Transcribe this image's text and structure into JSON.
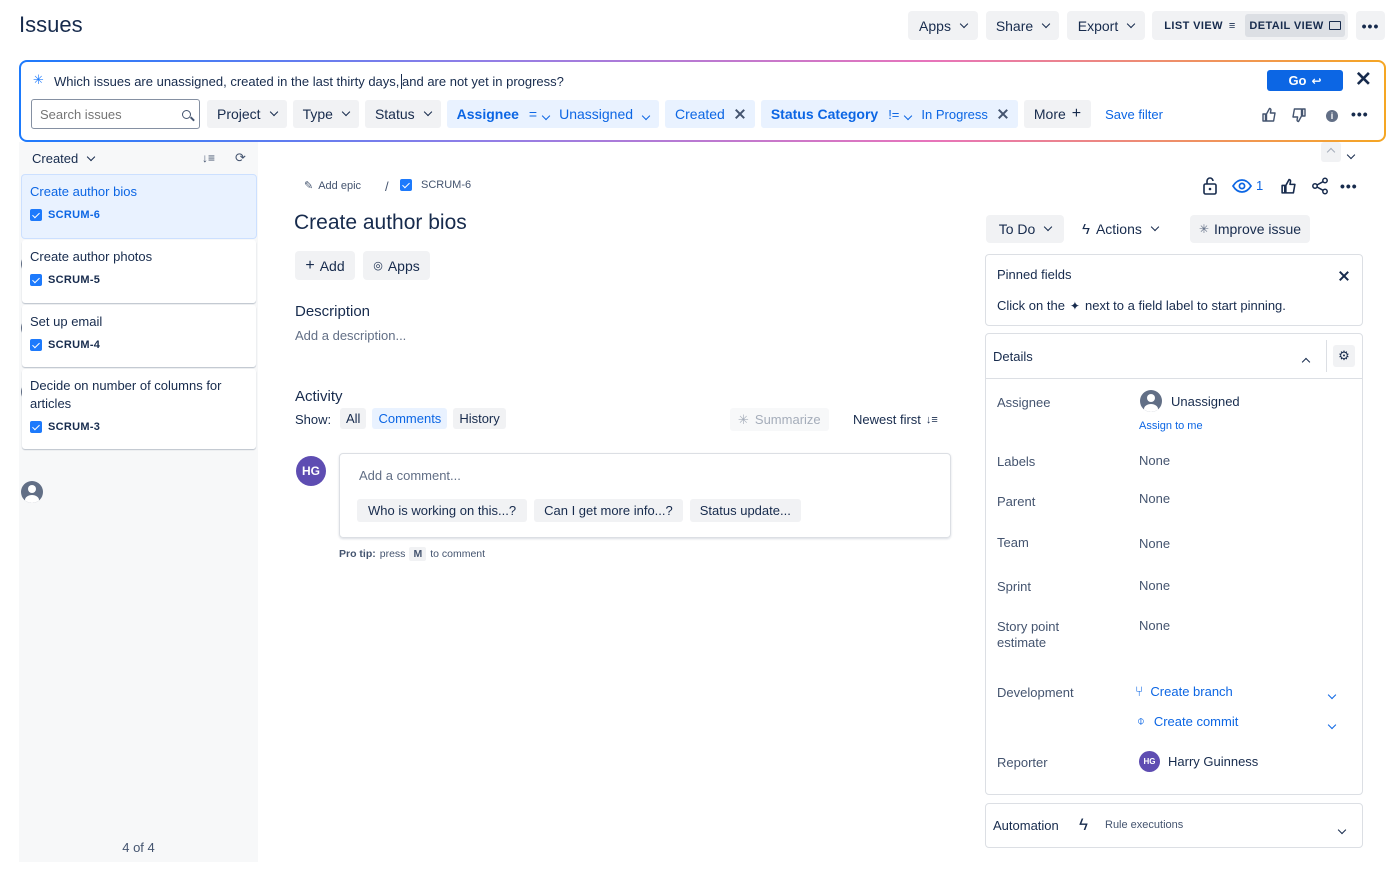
{
  "header": {
    "title": "Issues",
    "apps_label": "Apps",
    "share_label": "Share",
    "export_label": "Export",
    "list_view_label": "LIST VIEW",
    "detail_view_label": "DETAIL VIEW"
  },
  "ai_search": {
    "query_before": "Which issues are unassigned, created in the last thirty days, ",
    "query_after": "and are not yet in progress?",
    "go_label": "Go"
  },
  "filters": {
    "search_placeholder": "Search issues",
    "project": "Project",
    "type": "Type",
    "status": "Status",
    "assignee": "Assignee",
    "assignee_op": "=",
    "assignee_value": "Unassigned",
    "created": "Created",
    "status_category": "Status Category",
    "status_category_op": "!=",
    "status_category_value": "In Progress",
    "more": "More",
    "save_filter": "Save filter"
  },
  "list": {
    "sort_label": "Created",
    "count": "4 of 4",
    "items": [
      {
        "title": "Create author bios",
        "key": "SCRUM-6"
      },
      {
        "title": "Create author photos",
        "key": "SCRUM-5"
      },
      {
        "title": "Set up email",
        "key": "SCRUM-4"
      },
      {
        "title": "Decide on number of columns for articles",
        "key": "SCRUM-3"
      }
    ]
  },
  "issue": {
    "add_epic": "Add epic",
    "breadcrumb_sep": "/",
    "key": "SCRUM-6",
    "title": "Create author bios",
    "add_label": "Add",
    "apps_label": "Apps",
    "description_heading": "Description",
    "description_placeholder": "Add a description...",
    "watchers": "1",
    "activity": {
      "heading": "Activity",
      "show_label": "Show:",
      "tabs": [
        "All",
        "Comments",
        "History"
      ],
      "summarize": "Summarize",
      "sort": "Newest first",
      "avatar_initials": "HG",
      "comment_placeholder": "Add a comment...",
      "suggestions": [
        "Who is working on this...?",
        "Can I get more info...?",
        "Status update..."
      ],
      "pro_tip_prefix": "Pro tip:",
      "pro_tip_press": "press",
      "pro_tip_key": "M",
      "pro_tip_suffix": "to comment"
    }
  },
  "side": {
    "status": "To Do",
    "actions": "Actions",
    "improve": "Improve issue",
    "pinned": {
      "title": "Pinned fields",
      "text_before": "Click on the",
      "text_after": "next to a field label to start pinning."
    },
    "details": {
      "title": "Details",
      "assignee_label": "Assignee",
      "assignee_value": "Unassigned",
      "assign_to_me": "Assign to me",
      "labels_label": "Labels",
      "labels_value": "None",
      "parent_label": "Parent",
      "parent_value": "None",
      "team_label": "Team",
      "team_value": "None",
      "sprint_label": "Sprint",
      "sprint_value": "None",
      "story_label_1": "Story point",
      "story_label_2": "estimate",
      "story_value": "None",
      "development_label": "Development",
      "create_branch": "Create branch",
      "create_commit": "Create commit",
      "reporter_label": "Reporter",
      "reporter_initials": "HG",
      "reporter_name": "Harry Guinness"
    },
    "automation": {
      "title": "Automation",
      "rule_executions": "Rule executions"
    }
  },
  "colors": {
    "brand_blue": "#0c66e4",
    "avatar_purple": "#5e4db2",
    "selected_bg": "#e9f2ff"
  }
}
